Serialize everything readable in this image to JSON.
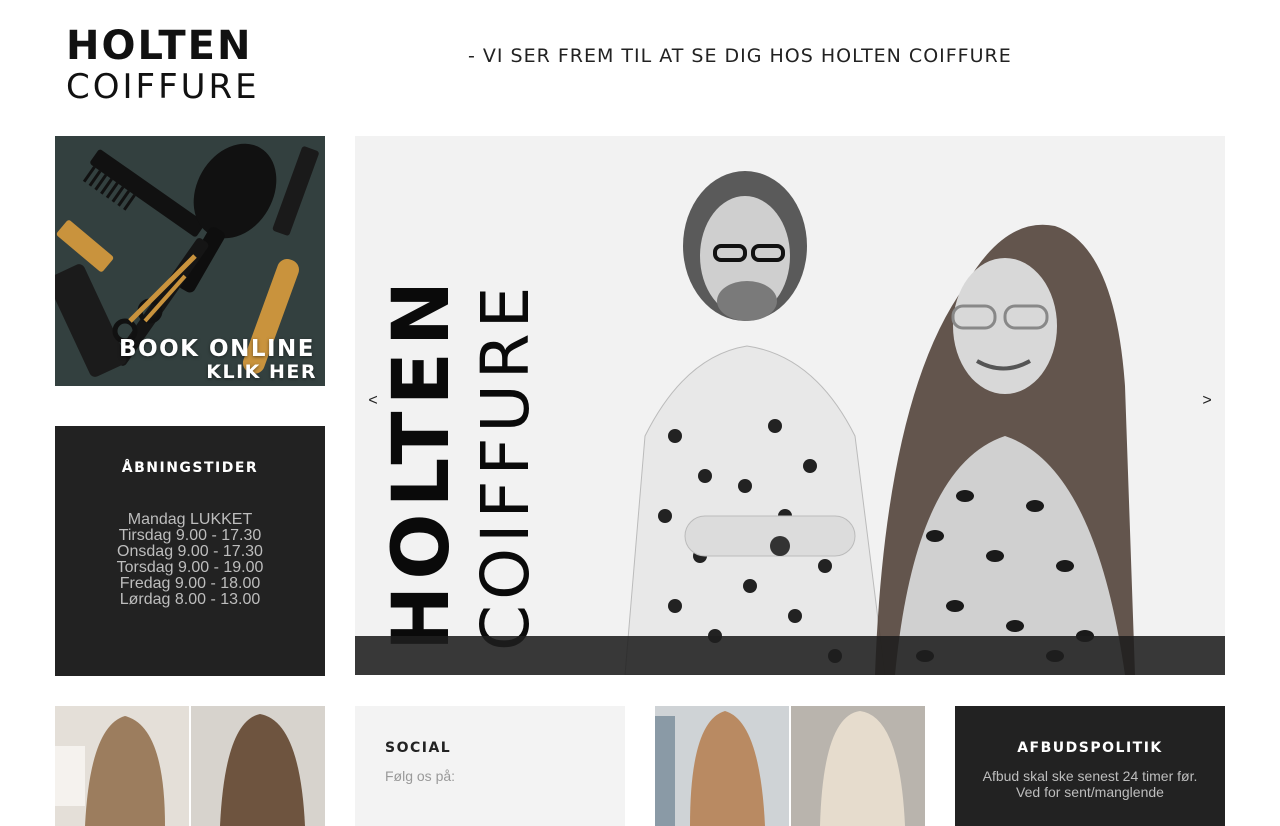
{
  "header": {
    "logo_line1": "HOLTEN",
    "logo_line2": "COIFFURE",
    "tagline": "- VI SER FREM TIL AT SE DIG HOS HOLTEN COIFFURE"
  },
  "book_online": {
    "title": "BOOK ONLINE",
    "subtitle": "KLIK HER"
  },
  "hours": {
    "title": "ÅBNINGSTIDER",
    "rows": [
      "Mandag LUKKET",
      "Tirsdag 9.00 - 17.30",
      "Onsdag 9.00 - 17.30",
      "Torsdag 9.00 - 19.00",
      "Fredag 9.00 - 18.00",
      "Lørdag 8.00 - 13.00"
    ]
  },
  "slider": {
    "text_line1": "HOLTEN",
    "text_line2": "COIFFURE",
    "prev_label": "<",
    "next_label": ">"
  },
  "social": {
    "title": "SOCIAL",
    "text": "Følg os på:"
  },
  "policy": {
    "title": "AFBUDSPOLITIK",
    "text": "Afbud skal ske senest 24 timer før. Ved for sent/manglende"
  },
  "colors": {
    "dark_tile": "#222222",
    "light_tile": "#f3f3f3",
    "hours_text": "#bdbdbd"
  }
}
